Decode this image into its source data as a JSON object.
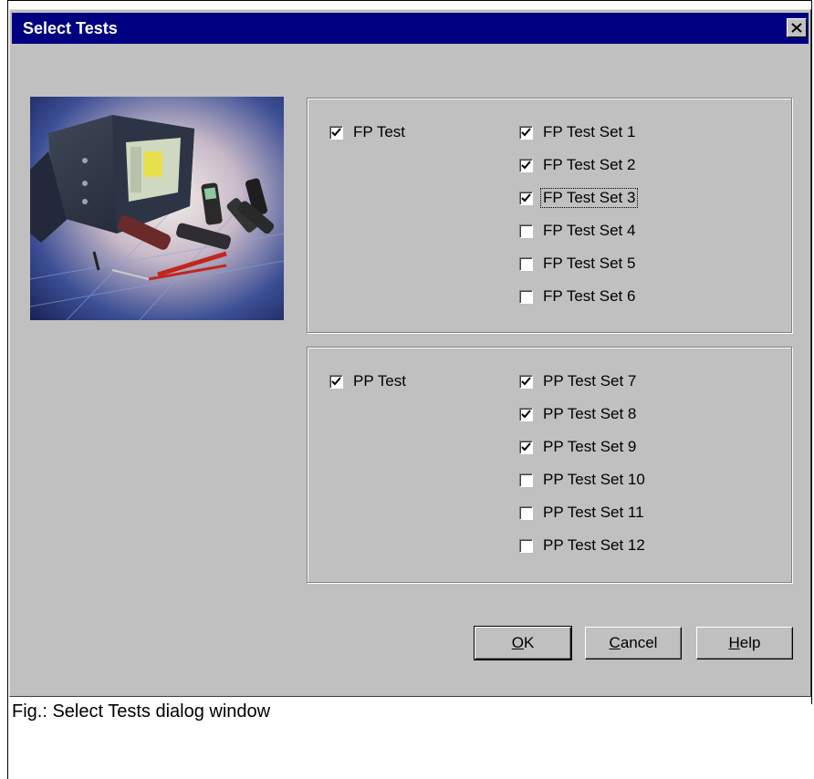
{
  "window": {
    "title": "Select Tests",
    "close_icon": "close-icon"
  },
  "photo": {
    "icon": "test-equipment-photo"
  },
  "fp_group": {
    "master": {
      "label": "FP Test",
      "checked": true
    },
    "items": [
      {
        "label": "FP Test Set  1",
        "checked": true
      },
      {
        "label": "FP Test Set  2",
        "checked": true
      },
      {
        "label": "FP Test Set  3",
        "checked": true,
        "focused": true
      },
      {
        "label": "FP Test Set  4",
        "checked": false
      },
      {
        "label": "FP Test Set  5",
        "checked": false
      },
      {
        "label": "FP Test Set  6",
        "checked": false
      }
    ]
  },
  "pp_group": {
    "master": {
      "label": "PP Test",
      "checked": true
    },
    "items": [
      {
        "label": "PP Test Set  7",
        "checked": true
      },
      {
        "label": "PP Test Set  8",
        "checked": true
      },
      {
        "label": "PP Test Set  9",
        "checked": true
      },
      {
        "label": "PP Test Set 10",
        "checked": false
      },
      {
        "label": "PP Test Set 11",
        "checked": false
      },
      {
        "label": "PP Test Set 12",
        "checked": false
      }
    ]
  },
  "buttons": {
    "ok": {
      "mnemonic": "O",
      "rest": "K"
    },
    "cancel": {
      "mnemonic": "C",
      "rest": "ancel"
    },
    "help": {
      "mnemonic": "H",
      "rest": "elp"
    }
  },
  "caption": "Fig.: Select Tests dialog window"
}
